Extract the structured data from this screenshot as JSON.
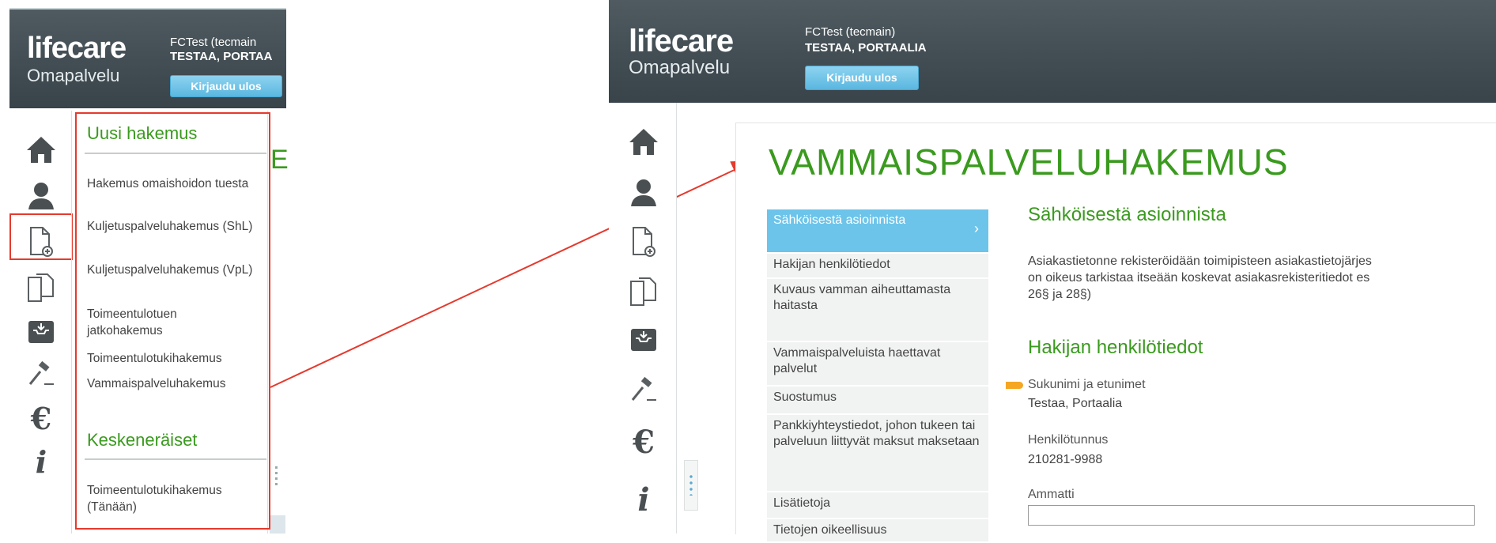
{
  "brand": {
    "name": "lifecare",
    "product": "Omapalvelu"
  },
  "left_panel": {
    "user_name": "FCTest (tecmain",
    "user_org": "TESTAA, PORTAA",
    "logout_label": "Kirjaudu ulos",
    "new_applications": {
      "heading": "Uusi hakemus",
      "items": [
        "Hakemus omaishoidon tuesta",
        "Kuljetuspalveluhakemus (ShL)",
        "Kuljetuspalveluhakemus (VpL)",
        "Toimeentulotuen jatkohakemus",
        "Toimeentulotukihakemus",
        "Vammaispalveluhakemus"
      ]
    },
    "unfinished": {
      "heading": "Keskeneräiset",
      "items": [
        "Toimeentulotukihakemus (Tänään)"
      ]
    },
    "cut_title_letter": "E"
  },
  "right_panel": {
    "user_name": "FCTest (tecmain)",
    "user_org": "TESTAA, PORTAALIA",
    "logout_label": "Kirjaudu ulos",
    "page_title": "VAMMAISPALVELUHAKEMUS",
    "nav": [
      "Sähköisestä asioinnista",
      "Hakijan henkilötiedot",
      "Kuvaus vamman aiheuttamasta haitasta",
      "Vammaispalveluista haettavat palvelut",
      "Suostumus",
      "Pankkiyhteystiedot, johon tukeen tai palveluun liittyvät maksut maksetaan",
      "Lisätietoja",
      "Tietojen oikeellisuus"
    ],
    "section1": {
      "title": "Sähköisestä asioinnista",
      "text_lines": [
        "Asiakastietonne rekisteröidään toimipisteen asiakastietojärjes",
        "on oikeus tarkistaa itseään koskevat asiakasrekisteritiedot es",
        "26§ ja 28§)"
      ]
    },
    "section2": {
      "title": "Hakijan henkilötiedot",
      "name_label": "Sukunimi ja etunimet",
      "name_value": "Testaa, Portaalia",
      "ssn_label": "Henkilötunnus",
      "ssn_value": "210281-9988",
      "occupation_label": "Ammatti",
      "occupation_value": ""
    }
  },
  "rail_icons": [
    "home-icon",
    "user-icon",
    "new-document-icon",
    "documents-icon",
    "inbox-icon",
    "gavel-icon",
    "euro-icon",
    "info-icon"
  ],
  "colors": {
    "accent_green": "#3a9a1e",
    "accent_blue": "#6cc4ea",
    "annotation_red": "#e53a2e",
    "header_dark": "#3e494f"
  }
}
